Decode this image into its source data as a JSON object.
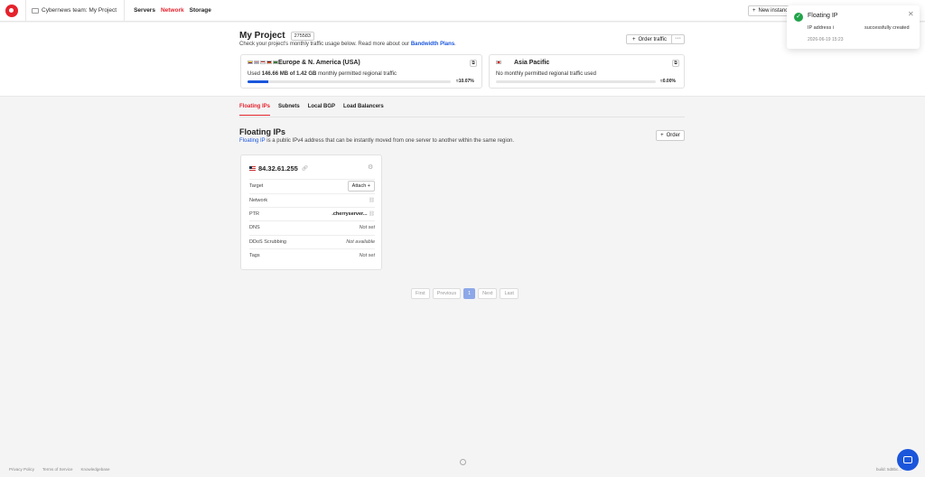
{
  "topbar": {
    "team_label": "Cybernews team: My Project",
    "nav": [
      "Servers",
      "Network",
      "Storage"
    ],
    "new_instance_label": "New instance"
  },
  "toast": {
    "title": "Floating IP",
    "message_part1": "IP address i",
    "message_part2": "successfully created",
    "timestamp": "2026-06-19 15:23",
    "close_icon": "close-icon"
  },
  "project": {
    "title": "My Project",
    "id": "275583",
    "subtitle_prefix": "Check your project's monthly traffic usage below. Read more about our ",
    "subtitle_link": "Bandwidth Plans",
    "subtitle_suffix": ".",
    "order_traffic_label": "Order traffic",
    "more_label": "···"
  },
  "regions": [
    {
      "name": "Europe & N. America (USA)",
      "usage_prefix": "Used ",
      "used": "146.66 MB of 1.42 GB",
      "usage_suffix": " monthly permitted regional traffic",
      "percent_label": "≈10.07%",
      "percent": 10.07
    },
    {
      "name": "Asia Pacific",
      "usage_prefix": "No monthly permitted regional traffic used",
      "used": "",
      "usage_suffix": "",
      "percent_label": "≈0.00%",
      "percent": 0
    }
  ],
  "tabs": [
    "Floating IPs",
    "Subnets",
    "Local BGP",
    "Load Balancers"
  ],
  "section": {
    "title": "Floating IPs",
    "subtitle_link": "Floating IP",
    "subtitle_rest": " is a public IPv4 address that can be instantly moved from one server to another within the same region.",
    "order_label": "Order"
  },
  "card": {
    "ip": "84.32.61.255",
    "rows": [
      {
        "label": "Target",
        "value": "Attach +"
      },
      {
        "label": "Network",
        "value": ""
      },
      {
        "label": "PTR",
        "value": ".cherryserver..."
      },
      {
        "label": "DNS",
        "value": "Not set"
      },
      {
        "label": "DDoS Scrubbing",
        "value": "Not available"
      },
      {
        "label": "Tags",
        "value": "Not set"
      }
    ]
  },
  "pager": [
    "First",
    "Previous",
    "1",
    "Next",
    "Last"
  ],
  "footer": [
    "Privacy Policy",
    "Terms of Service",
    "Knowledgebase"
  ],
  "build": "build: 5d8bc..."
}
